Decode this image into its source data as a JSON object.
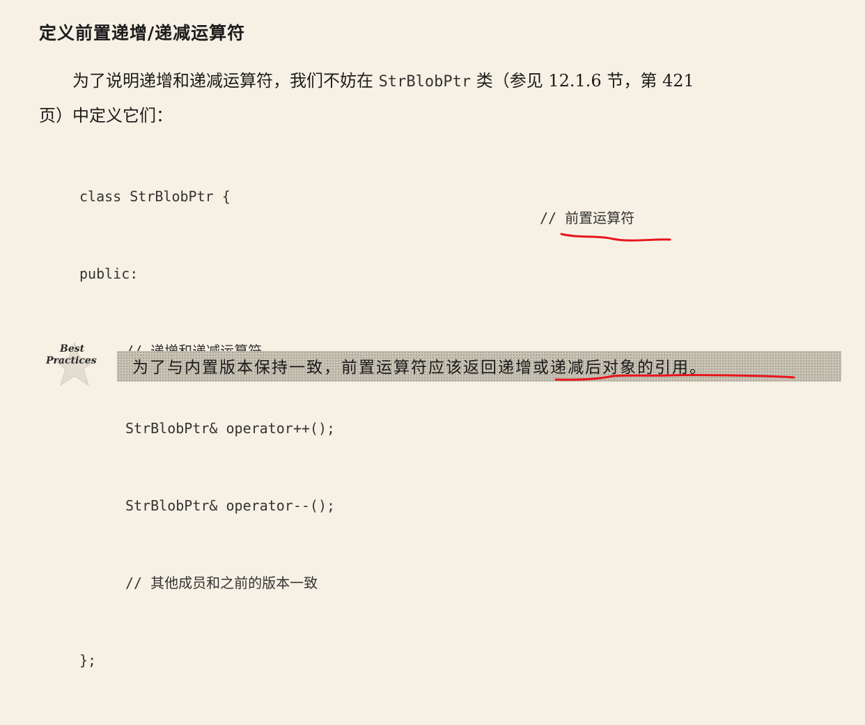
{
  "section": {
    "heading": "定义前置递增/递减运算符"
  },
  "paragraph": {
    "line1_before": "为了说明递增和递减运算符，我们不妨在 ",
    "line1_code": "StrBlobPtr",
    "line1_after": " 类（参见 12.1.6 节，第 421",
    "line2": "页）中定义它们："
  },
  "code": {
    "line1": "class StrBlobPtr {",
    "line2": "public:",
    "line3": "// 递增和递减运算符",
    "line4": "StrBlobPtr& operator++();",
    "line4_comment": "// 前置运算符",
    "line5": "StrBlobPtr& operator--();",
    "line6": "// 其他成员和之前的版本一致",
    "line7": "};"
  },
  "best_practices": {
    "label_line1": "Best",
    "label_line2": "Practices",
    "text": "为了与内置版本保持一致，前置运算符应该返回递增或递减后对象的引用。"
  },
  "colors": {
    "page_background": "#f6f1e4",
    "highlight_box": "#c9c4b6",
    "annotation_ink": "#e8141c"
  }
}
